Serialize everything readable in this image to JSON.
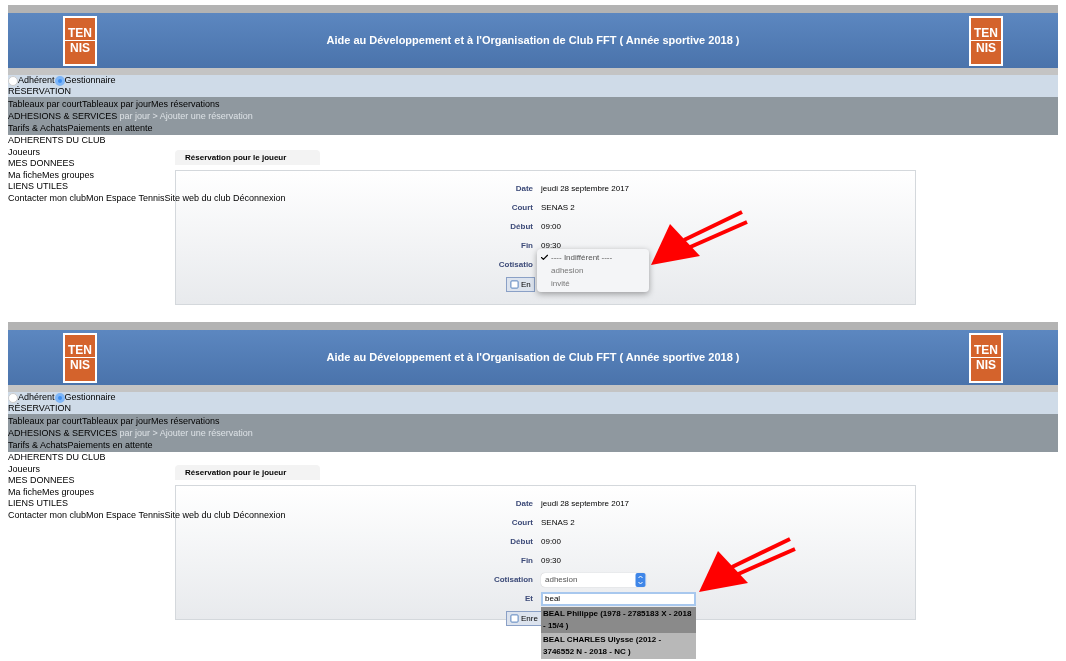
{
  "panels": [
    {
      "header": {
        "title": "Aide au Développement et à l'Organisation de Club FFT (  Année sportive 2018  )",
        "logos": [
          {
            "top": "TEN",
            "bottom": "NIS"
          },
          {
            "top": "TEN",
            "bottom": "NIS"
          }
        ]
      },
      "roles": [
        {
          "label": "Adhérent",
          "selected": false
        },
        {
          "label": "Gestionnaire",
          "selected": true
        }
      ],
      "menu_lines": [
        "RÉSERVATION",
        "Tableaux par courtTableaux par jourMes réservations",
        "ADHESIONS & SERVICES",
        "Tarifs & AchatsPaiements en attente",
        "ADHERENTS DU CLUB",
        "Joueurs",
        "MES DONNEES",
        "Ma ficheMes groupes",
        "LIENS UTILES",
        "Contacter mon clubMon Espace TennisSite web du club Déconnexion"
      ],
      "breadcrumb": "par jour > Ajouter une réservation",
      "section_title": "Réservation pour le joueur",
      "rows": [
        {
          "kind": "text",
          "label": "Date",
          "value": "jeudi 28 septembre 2017"
        },
        {
          "kind": "text",
          "label": "Court",
          "value": "SENAS 2"
        },
        {
          "kind": "text",
          "label": "Début",
          "value": "09:00"
        },
        {
          "kind": "text",
          "label": "Fin",
          "value": "09:30"
        },
        {
          "kind": "menu",
          "label": "Cotisatio",
          "options": [
            {
              "label": "---- Indifférent ----",
              "selected": true
            },
            {
              "label": "adhesion",
              "selected": false
            },
            {
              "label": "invité",
              "selected": false
            }
          ]
        }
      ],
      "button": "En"
    },
    {
      "header": {
        "title": "Aide au Développement et à l'Organisation de Club FFT (  Année sportive 2018  )",
        "logos": [
          {
            "top": "TEN",
            "bottom": "NIS"
          },
          {
            "top": "TEN",
            "bottom": "NIS"
          }
        ]
      },
      "roles": [
        {
          "label": "Adhérent",
          "selected": false
        },
        {
          "label": "Gestionnaire",
          "selected": true
        }
      ],
      "menu_lines": [
        "RÉSERVATION",
        "Tableaux par courtTableaux par jourMes réservations",
        "ADHESIONS & SERVICES",
        "Tarifs & AchatsPaiements en attente",
        "ADHERENTS DU CLUB",
        "Joueurs",
        "MES DONNEES",
        "Ma ficheMes groupes",
        "LIENS UTILES",
        "Contacter mon clubMon Espace TennisSite web du club Déconnexion"
      ],
      "breadcrumb": "par jour > Ajouter une réservation",
      "section_title": "Réservation pour le joueur",
      "rows": [
        {
          "kind": "text",
          "label": "Date",
          "value": "jeudi 28 septembre 2017"
        },
        {
          "kind": "text",
          "label": "Court",
          "value": "SENAS 2"
        },
        {
          "kind": "text",
          "label": "Début",
          "value": "09:00"
        },
        {
          "kind": "text",
          "label": "Fin",
          "value": "09:30"
        },
        {
          "kind": "select",
          "label": "Cotisation",
          "value": "adhesion"
        },
        {
          "kind": "search",
          "label": "Et",
          "value": "beal",
          "suggestions": [
            {
              "text": "BEAL Philippe (1978 - 2785183 X - 2018 - 15/4 )",
              "selected": true
            },
            {
              "text": "BEAL CHARLES Ulysse (2012 - 3746552 N - 2018 - NC )",
              "selected": false
            }
          ]
        }
      ],
      "button": "Enre"
    }
  ]
}
